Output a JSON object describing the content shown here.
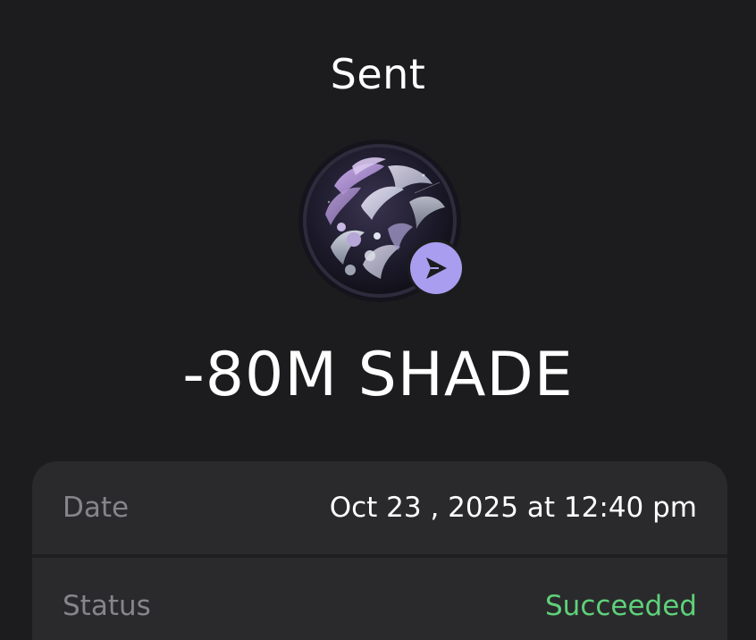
{
  "header": {
    "title": "Sent"
  },
  "token": {
    "logo_icon": "orb-logo-icon",
    "badge_icon": "send-arrow-icon",
    "badge_color": "#a99df0"
  },
  "transaction": {
    "amount": "-80M SHADE"
  },
  "details": {
    "date_label": "Date",
    "date_value": "Oct 23 , 2025 at 12:40 pm",
    "status_label": "Status",
    "status_value": "Succeeded",
    "status_color": "#5ed17a"
  }
}
